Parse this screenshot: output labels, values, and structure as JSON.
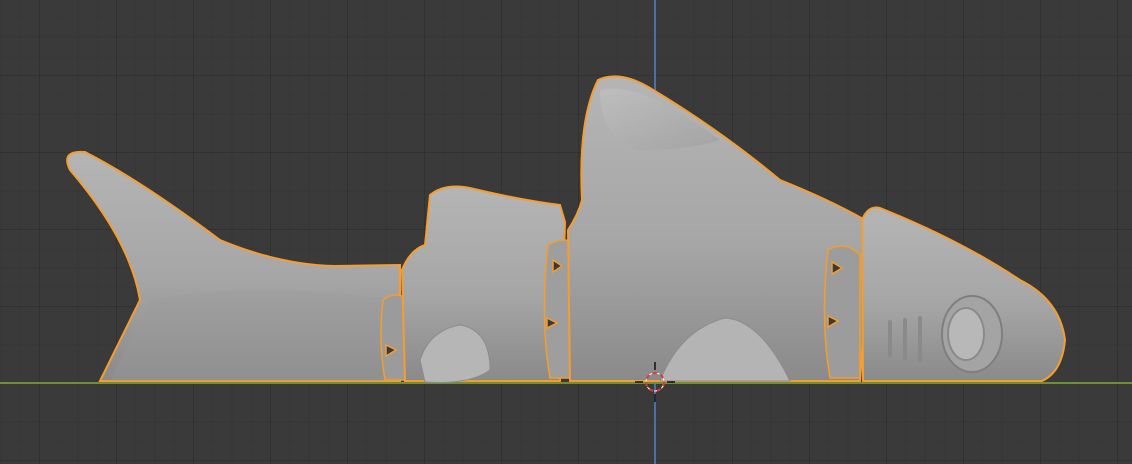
{
  "viewport": {
    "name": "3D Viewport",
    "object_name": "shark",
    "selected": true
  },
  "colors": {
    "background": "#3a3a3a",
    "grid": "#323232",
    "x_axis": "#6e8f33",
    "z_axis": "#4f6ea3",
    "selection_outline": "#f59d2f",
    "mesh": "#a9a9a9",
    "mesh_shadow": "#7c7c7c",
    "cursor_red": "#e03a3a"
  },
  "icons": {
    "cursor": "3d-cursor-icon"
  }
}
